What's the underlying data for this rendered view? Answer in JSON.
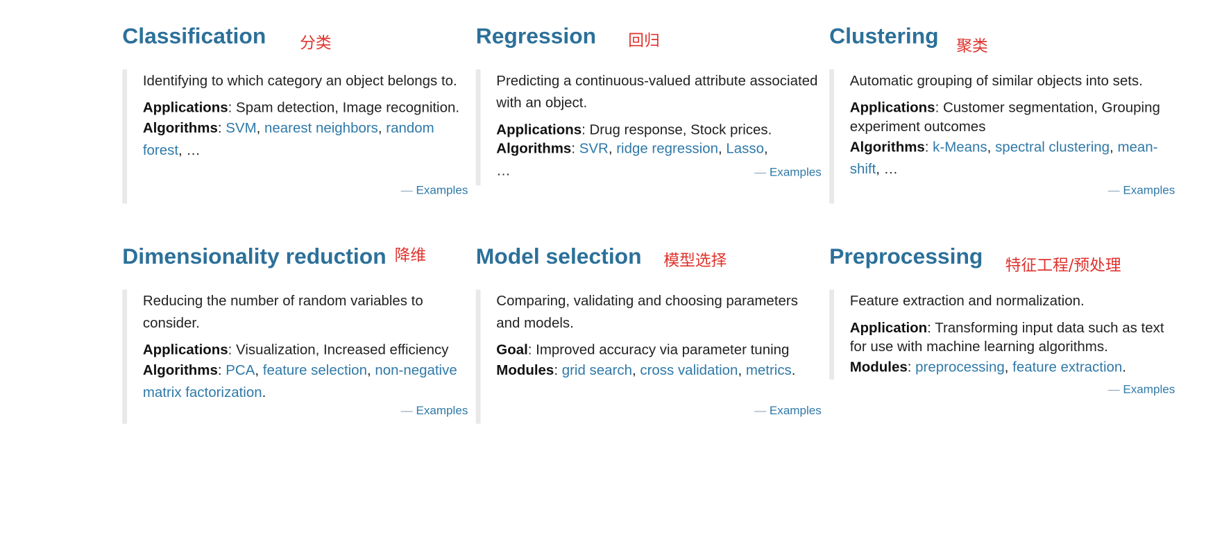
{
  "sections": [
    {
      "title": "Classification",
      "note": "分类",
      "description": "Identifying to which category an object belongs to.",
      "rows": [
        {
          "label": "Applications",
          "text": "Spam detection, Image recognition."
        },
        {
          "label": "Algorithms",
          "links": [
            "SVM",
            "nearest neighbors",
            "random forest"
          ],
          "suffix": "…"
        }
      ],
      "examples": "Examples"
    },
    {
      "title": "Regression",
      "note": "回归",
      "description": "Predicting a continuous-valued attribute associated with an object.",
      "rows": [
        {
          "label": "Applications",
          "text": "Drug response, Stock prices."
        },
        {
          "label": "Algorithms",
          "links": [
            "SVR",
            "ridge regression",
            "Lasso"
          ],
          "suffix": "…"
        }
      ],
      "examples": "Examples"
    },
    {
      "title": "Clustering",
      "note": "聚类",
      "description": "Automatic grouping of similar objects into sets.",
      "rows": [
        {
          "label": "Applications",
          "text": "Customer segmentation, Grouping experiment outcomes"
        },
        {
          "label": "Algorithms",
          "links": [
            "k-Means",
            "spectral clustering",
            "mean-shift"
          ],
          "suffix": "…"
        }
      ],
      "examples": "Examples"
    },
    {
      "title": "Dimensionality reduction",
      "note": "降维",
      "description": "Reducing the number of random variables to consider.",
      "rows": [
        {
          "label": "Applications",
          "text": "Visualization, Increased efficiency"
        },
        {
          "label": "Algorithms",
          "links": [
            "PCA",
            "feature selection",
            "non-negative matrix factorization"
          ],
          "suffix": "."
        }
      ],
      "examples": "Examples"
    },
    {
      "title": "Model selection",
      "note": "模型选择",
      "description": "Comparing, validating and choosing parameters and models.",
      "rows": [
        {
          "label": "Goal",
          "text": "Improved accuracy via parameter tuning"
        },
        {
          "label": "Modules",
          "links": [
            "grid search",
            "cross validation",
            "metrics"
          ],
          "suffix": "."
        }
      ],
      "examples": "Examples"
    },
    {
      "title": "Preprocessing",
      "note": "特征工程/预处理",
      "description": "Feature extraction and normalization.",
      "rows": [
        {
          "label": "Application",
          "text": "Transforming input data such as text for use with machine learning algorithms."
        },
        {
          "label": "Modules",
          "links": [
            "preprocessing",
            "feature extraction"
          ],
          "suffix": "."
        }
      ],
      "examples": "Examples"
    }
  ]
}
